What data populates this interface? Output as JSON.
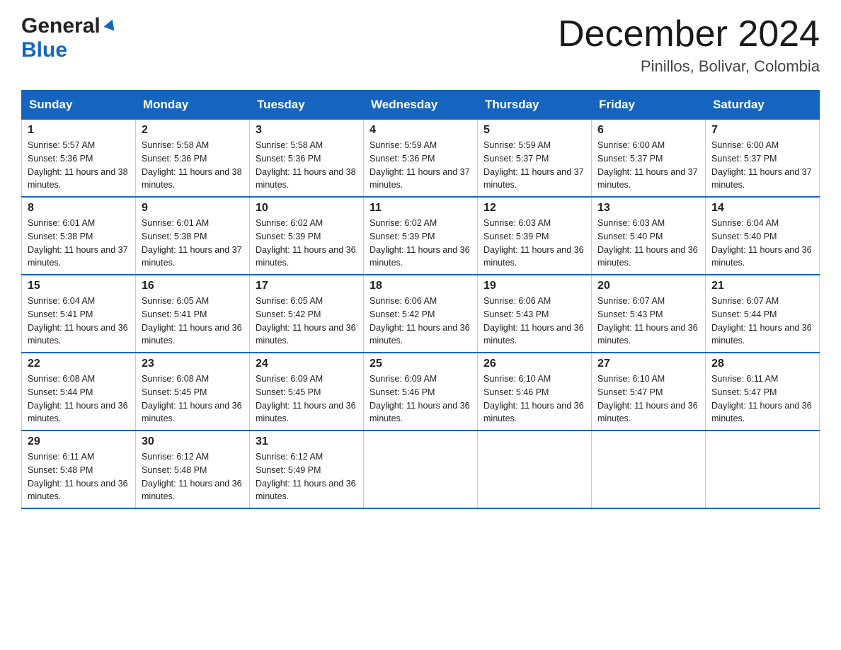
{
  "header": {
    "logo_general": "General",
    "logo_blue": "Blue",
    "month_title": "December 2024",
    "subtitle": "Pinillos, Bolivar, Colombia"
  },
  "days_of_week": [
    "Sunday",
    "Monday",
    "Tuesday",
    "Wednesday",
    "Thursday",
    "Friday",
    "Saturday"
  ],
  "weeks": [
    [
      {
        "day": "1",
        "sunrise": "5:57 AM",
        "sunset": "5:36 PM",
        "daylight": "11 hours and 38 minutes."
      },
      {
        "day": "2",
        "sunrise": "5:58 AM",
        "sunset": "5:36 PM",
        "daylight": "11 hours and 38 minutes."
      },
      {
        "day": "3",
        "sunrise": "5:58 AM",
        "sunset": "5:36 PM",
        "daylight": "11 hours and 38 minutes."
      },
      {
        "day": "4",
        "sunrise": "5:59 AM",
        "sunset": "5:36 PM",
        "daylight": "11 hours and 37 minutes."
      },
      {
        "day": "5",
        "sunrise": "5:59 AM",
        "sunset": "5:37 PM",
        "daylight": "11 hours and 37 minutes."
      },
      {
        "day": "6",
        "sunrise": "6:00 AM",
        "sunset": "5:37 PM",
        "daylight": "11 hours and 37 minutes."
      },
      {
        "day": "7",
        "sunrise": "6:00 AM",
        "sunset": "5:37 PM",
        "daylight": "11 hours and 37 minutes."
      }
    ],
    [
      {
        "day": "8",
        "sunrise": "6:01 AM",
        "sunset": "5:38 PM",
        "daylight": "11 hours and 37 minutes."
      },
      {
        "day": "9",
        "sunrise": "6:01 AM",
        "sunset": "5:38 PM",
        "daylight": "11 hours and 37 minutes."
      },
      {
        "day": "10",
        "sunrise": "6:02 AM",
        "sunset": "5:39 PM",
        "daylight": "11 hours and 36 minutes."
      },
      {
        "day": "11",
        "sunrise": "6:02 AM",
        "sunset": "5:39 PM",
        "daylight": "11 hours and 36 minutes."
      },
      {
        "day": "12",
        "sunrise": "6:03 AM",
        "sunset": "5:39 PM",
        "daylight": "11 hours and 36 minutes."
      },
      {
        "day": "13",
        "sunrise": "6:03 AM",
        "sunset": "5:40 PM",
        "daylight": "11 hours and 36 minutes."
      },
      {
        "day": "14",
        "sunrise": "6:04 AM",
        "sunset": "5:40 PM",
        "daylight": "11 hours and 36 minutes."
      }
    ],
    [
      {
        "day": "15",
        "sunrise": "6:04 AM",
        "sunset": "5:41 PM",
        "daylight": "11 hours and 36 minutes."
      },
      {
        "day": "16",
        "sunrise": "6:05 AM",
        "sunset": "5:41 PM",
        "daylight": "11 hours and 36 minutes."
      },
      {
        "day": "17",
        "sunrise": "6:05 AM",
        "sunset": "5:42 PM",
        "daylight": "11 hours and 36 minutes."
      },
      {
        "day": "18",
        "sunrise": "6:06 AM",
        "sunset": "5:42 PM",
        "daylight": "11 hours and 36 minutes."
      },
      {
        "day": "19",
        "sunrise": "6:06 AM",
        "sunset": "5:43 PM",
        "daylight": "11 hours and 36 minutes."
      },
      {
        "day": "20",
        "sunrise": "6:07 AM",
        "sunset": "5:43 PM",
        "daylight": "11 hours and 36 minutes."
      },
      {
        "day": "21",
        "sunrise": "6:07 AM",
        "sunset": "5:44 PM",
        "daylight": "11 hours and 36 minutes."
      }
    ],
    [
      {
        "day": "22",
        "sunrise": "6:08 AM",
        "sunset": "5:44 PM",
        "daylight": "11 hours and 36 minutes."
      },
      {
        "day": "23",
        "sunrise": "6:08 AM",
        "sunset": "5:45 PM",
        "daylight": "11 hours and 36 minutes."
      },
      {
        "day": "24",
        "sunrise": "6:09 AM",
        "sunset": "5:45 PM",
        "daylight": "11 hours and 36 minutes."
      },
      {
        "day": "25",
        "sunrise": "6:09 AM",
        "sunset": "5:46 PM",
        "daylight": "11 hours and 36 minutes."
      },
      {
        "day": "26",
        "sunrise": "6:10 AM",
        "sunset": "5:46 PM",
        "daylight": "11 hours and 36 minutes."
      },
      {
        "day": "27",
        "sunrise": "6:10 AM",
        "sunset": "5:47 PM",
        "daylight": "11 hours and 36 minutes."
      },
      {
        "day": "28",
        "sunrise": "6:11 AM",
        "sunset": "5:47 PM",
        "daylight": "11 hours and 36 minutes."
      }
    ],
    [
      {
        "day": "29",
        "sunrise": "6:11 AM",
        "sunset": "5:48 PM",
        "daylight": "11 hours and 36 minutes."
      },
      {
        "day": "30",
        "sunrise": "6:12 AM",
        "sunset": "5:48 PM",
        "daylight": "11 hours and 36 minutes."
      },
      {
        "day": "31",
        "sunrise": "6:12 AM",
        "sunset": "5:49 PM",
        "daylight": "11 hours and 36 minutes."
      },
      null,
      null,
      null,
      null
    ]
  ],
  "sunrise_label": "Sunrise:",
  "sunset_label": "Sunset:",
  "daylight_label": "Daylight:"
}
